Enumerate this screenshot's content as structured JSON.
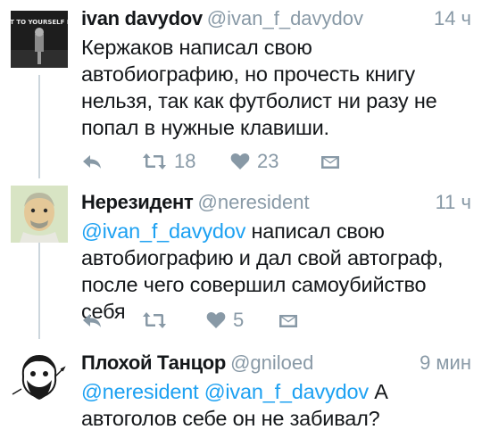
{
  "tweets": [
    {
      "name": "ivan davydov",
      "handle": "@ivan_f_davydov",
      "time": "14 ч",
      "avatar_caption": "KEEP IT TO YOURSELF BUDDY",
      "text": "Кержаков написал свою автобиографию, но прочесть книгу нельзя, так как футболист ни разу не попал в нужные клавиши.",
      "retweets": "18",
      "likes": "23"
    },
    {
      "name": "Нерезидент",
      "handle": "@neresident",
      "time": "11 ч",
      "mention": "@ivan_f_davydov",
      "text": " написал свою автобиографию и дал свой автограф, после чего совершил самоубийство себя",
      "retweets": "",
      "likes": "5"
    },
    {
      "name": "Плохой Танцор",
      "handle": "@gniloed",
      "time": "9 мин",
      "mention": "@neresident @ivan_f_davydov",
      "text": " А автоголов себе он не забивал?"
    }
  ],
  "colors": {
    "text": "#14171a",
    "secondary": "#8899a6",
    "link": "#1da1f2",
    "thread_line": "#ccd6dd"
  },
  "icons": [
    "reply-icon",
    "retweet-icon",
    "like-icon",
    "direct-message-icon"
  ]
}
